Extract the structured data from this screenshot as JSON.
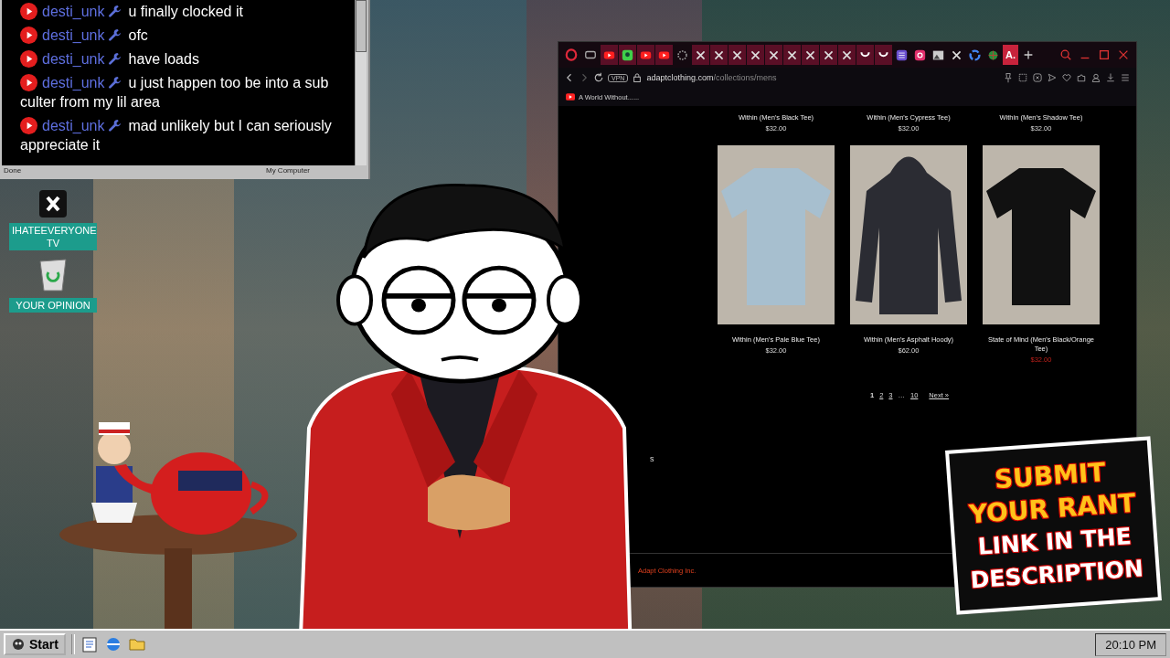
{
  "chat": {
    "messages": [
      {
        "user": "desti_unk",
        "moderator": true,
        "text": "u finally clocked it"
      },
      {
        "user": "desti_unk",
        "moderator": true,
        "text": "ofc"
      },
      {
        "user": "desti_unk",
        "moderator": true,
        "text": "have loads"
      },
      {
        "user": "desti_unk",
        "moderator": true,
        "text": "u just happen too be into a sub culter from my lil area"
      },
      {
        "user": "desti_unk",
        "moderator": true,
        "text": "mad unlikely but I can seriously appreciate it"
      }
    ],
    "status_bar": {
      "left": "Done",
      "right": "My Computer"
    }
  },
  "desktop_icons": [
    {
      "kind": "x-app",
      "label": "IHATEEVERYONE TV"
    },
    {
      "kind": "recycle-bin",
      "label": "YOUR OPINION"
    }
  ],
  "browser": {
    "tabs": [
      {
        "kind": "play",
        "grouped": true,
        "selected": false
      },
      {
        "kind": "leaf",
        "grouped": true,
        "selected": false
      },
      {
        "kind": "play",
        "grouped": true,
        "selected": false
      },
      {
        "kind": "play",
        "grouped": true,
        "selected": false
      },
      {
        "kind": "gear",
        "grouped": false,
        "selected": false
      },
      {
        "kind": "cross",
        "grouped": true,
        "selected": false
      },
      {
        "kind": "cross",
        "grouped": true,
        "selected": false
      },
      {
        "kind": "cross",
        "grouped": true,
        "selected": false
      },
      {
        "kind": "cross",
        "grouped": true,
        "selected": false
      },
      {
        "kind": "cross",
        "grouped": true,
        "selected": false
      },
      {
        "kind": "cross",
        "grouped": true,
        "selected": false
      },
      {
        "kind": "cross",
        "grouped": true,
        "selected": false
      },
      {
        "kind": "cross",
        "grouped": true,
        "selected": false
      },
      {
        "kind": "cross",
        "grouped": true,
        "selected": false
      },
      {
        "kind": "smile",
        "grouped": true,
        "selected": false
      },
      {
        "kind": "smile",
        "grouped": true,
        "selected": false
      },
      {
        "kind": "list",
        "grouped": false,
        "selected": false
      },
      {
        "kind": "camera",
        "grouped": false,
        "selected": false
      },
      {
        "kind": "picture",
        "grouped": false,
        "selected": false
      },
      {
        "kind": "cross",
        "grouped": false,
        "selected": false
      },
      {
        "kind": "g",
        "grouped": false,
        "selected": false
      },
      {
        "kind": "globe",
        "grouped": false,
        "selected": false
      },
      {
        "kind": "letter",
        "label": "A.",
        "grouped": false,
        "selected": true
      }
    ],
    "vpn_badge": "VPN",
    "address": {
      "domain": "adaptclothing.com",
      "path": "/collections/mens"
    },
    "bookmarks": [
      {
        "label": "A World Without......"
      }
    ],
    "page": {
      "previous_row": [
        {
          "name": "Within (Men's Black Tee)",
          "price": "$32.00",
          "on_sale": false
        },
        {
          "name": "Within (Men's Cypress Tee)",
          "price": "$32.00",
          "on_sale": false
        },
        {
          "name": "Within (Men's Shadow Tee)",
          "price": "$32.00",
          "on_sale": false
        }
      ],
      "products": [
        {
          "kind": "tee",
          "color": "#a7bfcf",
          "name": "Within (Men's Pale Blue Tee)",
          "price": "$32.00",
          "on_sale": false
        },
        {
          "kind": "hoodie",
          "color": "#2b2c33",
          "name": "Within (Men's Asphalt Hoody)",
          "price": "$62.00",
          "on_sale": false
        },
        {
          "kind": "tee",
          "color": "#111111",
          "name": "State of Mind (Men's Black/Orange Tee)",
          "price": "$32.00",
          "on_sale": true
        }
      ],
      "pagination": [
        {
          "kind": "page",
          "label": "1",
          "selected": true
        },
        {
          "kind": "page",
          "label": "2",
          "selected": false
        },
        {
          "kind": "page",
          "label": "3",
          "selected": false
        },
        {
          "kind": "gap",
          "label": "…",
          "selected": false
        },
        {
          "kind": "page",
          "label": "10",
          "selected": false
        },
        {
          "kind": "next",
          "label": "Next »",
          "selected": false
        }
      ],
      "stray_text": "s",
      "footer": "Adapt Clothing Inc."
    }
  },
  "sign": {
    "lines": [
      {
        "kind": "highlight",
        "text": "SUBMIT"
      },
      {
        "kind": "highlight",
        "text": "YOUR RANT"
      },
      {
        "kind": "plain",
        "text": "LINK IN THE"
      },
      {
        "kind": "plain",
        "text": "DESCRIPTION"
      }
    ]
  },
  "taskbar": {
    "start": "Start",
    "quick_launch": [
      {
        "kind": "notepad"
      },
      {
        "kind": "browser"
      },
      {
        "kind": "folder"
      }
    ],
    "clock": "20:10 PM"
  }
}
